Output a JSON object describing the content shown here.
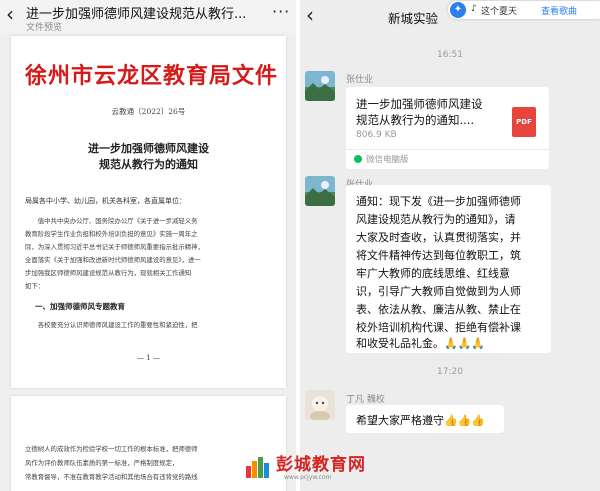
{
  "left_panel": {
    "back_icon": "back-chevron-icon",
    "title": "进一步加强师德师风建设规范从教行...",
    "subtitle": "文件预览",
    "more_icon": "more-icon",
    "document": {
      "header": "徐州市云龙区教育局文件",
      "doc_number": "云教通〔2022〕26号",
      "title_line1": "进一步加强师德师风建设",
      "title_line2": "规范从教行为的通知",
      "recipients": "局属各中小学、幼儿园，机关各科室，各直属单位：",
      "body_lines": [
        "　　值中共中央办公厅、国务院办公厅《关于进一步减轻义务",
        "教育阶段学生作业负担和校外培训负担的意见》实施一周年之",
        "际，为深入贯彻习近平总书记关于师德师风重要指示批示精神，",
        "全面落实《关于加强和改进新时代师德师风建设的意见》，进一",
        "步加强我区师德师风建设规范从教行为，现就相关工作通知",
        "如下："
      ],
      "section_heading": "一、加强师德师风专题教育",
      "section_line": "　　各校要充分认识师德师风建设工作的重要性和紧迫性，把",
      "page_number": "— 1 —",
      "page2_lines": [
        "立德树人的成效作为检验学校一切工作的根本标准，把师德师",
        "风作为评价教师队伍素质的第一标准，严格制度规定，",
        "常教育督导，不准在教育教学活动和其他场合有违背党的路线"
      ]
    }
  },
  "chat": {
    "back_icon": "back-chevron-icon",
    "title": "新城实验",
    "music": {
      "mark": "♪",
      "song": "这个夏天",
      "link": "查看歌曲"
    },
    "time1": "16:51",
    "time2": "17:20",
    "sender1": "张仕业",
    "file_card": {
      "name_line1": "进一步加强师德师风建设",
      "name_line2": "规范从教行为的通知....",
      "size": "806.9 KB",
      "file_type": "PDF",
      "source": "微信电脑版"
    },
    "sender2": "张仕业",
    "message_lines": [
      "通知：现下发《进一步加强师德师",
      "风建设规范从教行为的通知》，请",
      "大家及时查收，认真贯彻落实，并",
      "将文件精神传达到每位教职工，筑",
      "牢广大教师的底线思维、红线意",
      "识，引导广大教师自觉做到为人师",
      "表、依法从教、廉洁从教、禁止在",
      "校外培训机构代课、拒绝有偿补课",
      "和收受礼品礼金。🙏🙏🙏"
    ],
    "sender3": "丁凡 魏校",
    "reply": "希望大家严格遵守👍👍👍"
  },
  "watermark": {
    "text": "彭城教育网",
    "url": "www.pcjyw.com"
  },
  "colors": {
    "doc_header_red": "#d61a1a",
    "pdf_red": "#e7453c",
    "link_blue": "#2d7ff0",
    "wechat_green": "#07c160",
    "chat_bg": "#ededed"
  }
}
